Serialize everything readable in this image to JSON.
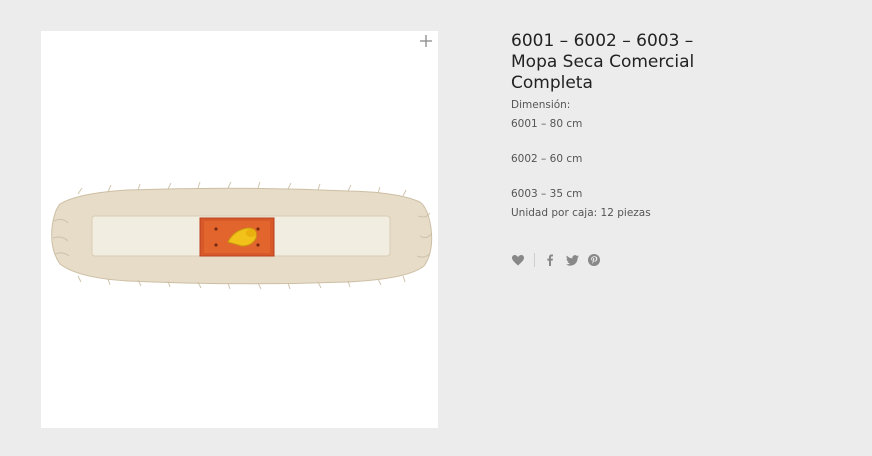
{
  "product": {
    "title": "6001 – 6002 – 6003 – Mopa Seca Comercial Completa",
    "image_alt": "Mopa Seca Comercial Completa",
    "description": [
      "Dimensión:",
      "6001 – 80 cm",
      "6002 – 60 cm",
      "6003 – 35 cm",
      "Unidad por caja: 12 piezas"
    ]
  },
  "icons": {
    "zoom": "plus-icon",
    "wishlist": "heart-icon",
    "facebook": "facebook-icon",
    "twitter": "twitter-icon",
    "pinterest": "pinterest-icon"
  },
  "colors": {
    "background": "#ececec",
    "icon": "#888888",
    "title": "#222222",
    "text": "#555555"
  }
}
